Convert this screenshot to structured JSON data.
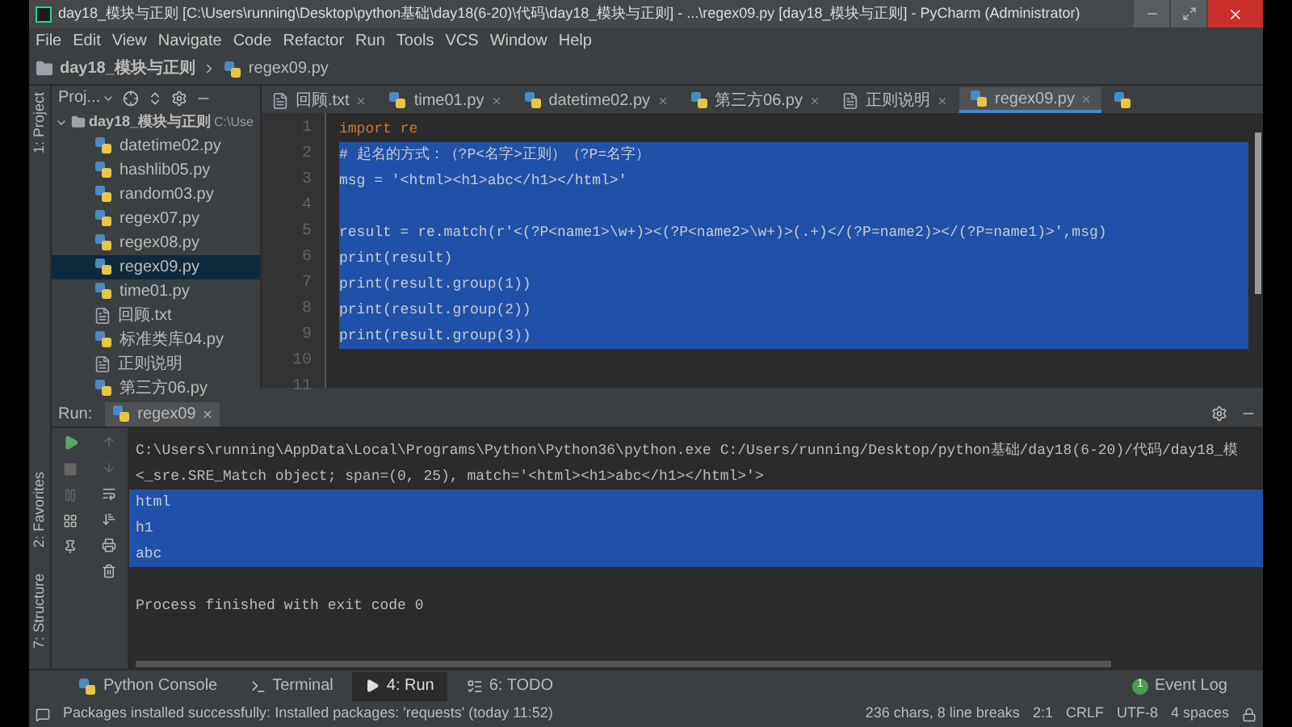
{
  "window": {
    "title": "day18_模块与正则 [C:\\Users\\running\\Desktop\\python基础\\day18(6-20)\\代码\\day18_模块与正则] - ...\\regex09.py [day18_模块与正则] - PyCharm (Administrator)"
  },
  "menu": [
    "File",
    "Edit",
    "View",
    "Navigate",
    "Code",
    "Refactor",
    "Run",
    "Tools",
    "VCS",
    "Window",
    "Help"
  ],
  "breadcrumb": [
    "day18_模块与正则",
    "regex09.py"
  ],
  "left_strip": [
    "1: Project",
    "2: Favorites",
    "7: Structure"
  ],
  "project": {
    "header": "Proj...",
    "root": "day18_模块与正则",
    "root_path": "C:\\Use",
    "items": [
      {
        "name": "datetime02.py",
        "kind": "py",
        "selected": false
      },
      {
        "name": "hashlib05.py",
        "kind": "py",
        "selected": false
      },
      {
        "name": "random03.py",
        "kind": "py",
        "selected": false
      },
      {
        "name": "regex07.py",
        "kind": "py",
        "selected": false
      },
      {
        "name": "regex08.py",
        "kind": "py",
        "selected": false
      },
      {
        "name": "regex09.py",
        "kind": "py",
        "selected": true
      },
      {
        "name": "time01.py",
        "kind": "py",
        "selected": false
      },
      {
        "name": "回顾.txt",
        "kind": "text",
        "selected": false
      },
      {
        "name": "标准类库04.py",
        "kind": "py",
        "selected": false
      },
      {
        "name": "正则说明",
        "kind": "text",
        "selected": false
      },
      {
        "name": "第三方06.py",
        "kind": "py",
        "selected": false
      }
    ]
  },
  "tabs": [
    {
      "label": "回顾.txt",
      "kind": "text",
      "selected": false
    },
    {
      "label": "time01.py",
      "kind": "py",
      "selected": false
    },
    {
      "label": "datetime02.py",
      "kind": "py",
      "selected": false
    },
    {
      "label": "第三方06.py",
      "kind": "py",
      "selected": false
    },
    {
      "label": "正则说明",
      "kind": "text",
      "selected": false
    },
    {
      "label": "regex09.py",
      "kind": "py",
      "selected": true
    },
    {
      "kind": "py",
      "selected": false
    }
  ],
  "editor": {
    "lines": [
      {
        "number": "1",
        "text": "import re",
        "selected": false
      },
      {
        "number": "2",
        "text": "# 起名的方式：（?P<名字>正则）（?P=名字）",
        "selected": true
      },
      {
        "number": "3",
        "text": "msg = '<html><h1>abc</h1></html>'",
        "selected": true
      },
      {
        "number": "4",
        "selected": true
      },
      {
        "number": "5",
        "text": "result = re.match(r'<(?P<name1>\\w+)><(?P<name2>\\w+)>(.+)</(?P=name2)></(?P=name1)>',msg)",
        "selected": true
      },
      {
        "number": "6",
        "text": "print(result)",
        "selected": true
      },
      {
        "number": "7",
        "text": "print(result.group(1))",
        "selected": true
      },
      {
        "number": "8",
        "text": "print(result.group(2))",
        "selected": true
      },
      {
        "number": "9",
        "text": "print(result.group(3))",
        "selected": true
      },
      {
        "number": "10",
        "selected": false
      },
      {
        "number": "11",
        "selected": false
      }
    ]
  },
  "run": {
    "label": "Run:",
    "tab": "regex09",
    "lines": [
      {
        "text": "C:\\Users\\running\\AppData\\Local\\Programs\\Python\\Python36\\python.exe C:/Users/running/Desktop/python基础/day18(6-20)/代码/day18_模",
        "selected": false
      },
      {
        "text": "<_sre.SRE_Match object; span=(0, 25), match='<html><h1>abc</h1></html>'>",
        "selected": false
      },
      {
        "text": "html",
        "selected": true
      },
      {
        "text": "h1",
        "selected": true
      },
      {
        "text": "abc",
        "selected": true
      }
    ],
    "exit_message": "Process finished with exit code 0"
  },
  "tool_tabs": [
    {
      "label": "Python Console",
      "kind": "python",
      "selected": false
    },
    {
      "label": "Terminal",
      "kind": "terminal",
      "selected": false
    },
    {
      "label": "4: Run",
      "kind": "run",
      "selected": true
    },
    {
      "label": "6: TODO",
      "kind": "todo",
      "selected": false
    }
  ],
  "event_log": {
    "badge": "1",
    "label": "Event Log"
  },
  "status_bar": {
    "message": "Packages installed successfully: Installed packages: 'requests' (today 11:52)",
    "selection": "236 chars, 8 line breaks",
    "position": "2:1",
    "line_separator": "CRLF",
    "encoding": "UTF-8",
    "indent": "4 spaces"
  }
}
